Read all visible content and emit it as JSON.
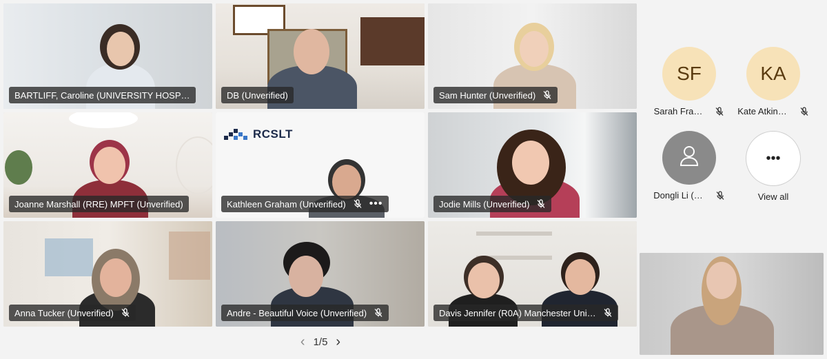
{
  "tiles": [
    {
      "name": "BARTLIFF, Caroline (UNIVERSITY HOSP…",
      "muted": false
    },
    {
      "name": "DB (Unverified)",
      "muted": false
    },
    {
      "name": "Sam Hunter (Unverified)",
      "muted": true
    },
    {
      "name": "Joanne Marshall (RRE) MPFT (Unverified)",
      "muted": false
    },
    {
      "name": "Kathleen Graham (Unverified)",
      "muted": true,
      "more": "•••"
    },
    {
      "name": "Jodie Mills (Unverified)",
      "muted": true
    },
    {
      "name": "Anna Tucker (Unverified)",
      "muted": true
    },
    {
      "name": "Andre - Beautiful Voice (Unverified)",
      "muted": true
    },
    {
      "name": "Davis Jennifer (R0A) Manchester Uni…",
      "muted": true
    }
  ],
  "rcslt_logo": "RCSLT",
  "side_participants": [
    {
      "initials": "SF",
      "name": "Sarah Fra…",
      "muted": true
    },
    {
      "initials": "KA",
      "name": "Kate Atkin…",
      "muted": true
    },
    {
      "initials": "",
      "name": "Dongli Li (…",
      "muted": true,
      "icon": "person-icon"
    },
    {
      "initials": "•••",
      "name": "View all",
      "icon": "more-icon"
    }
  ],
  "pager": {
    "label": "1/5",
    "prev": "‹",
    "next": "›"
  },
  "colors": {
    "tag_bg": "#282828",
    "avatar_bg": "#f7e2b8",
    "page_bg": "#f3f3f3"
  }
}
